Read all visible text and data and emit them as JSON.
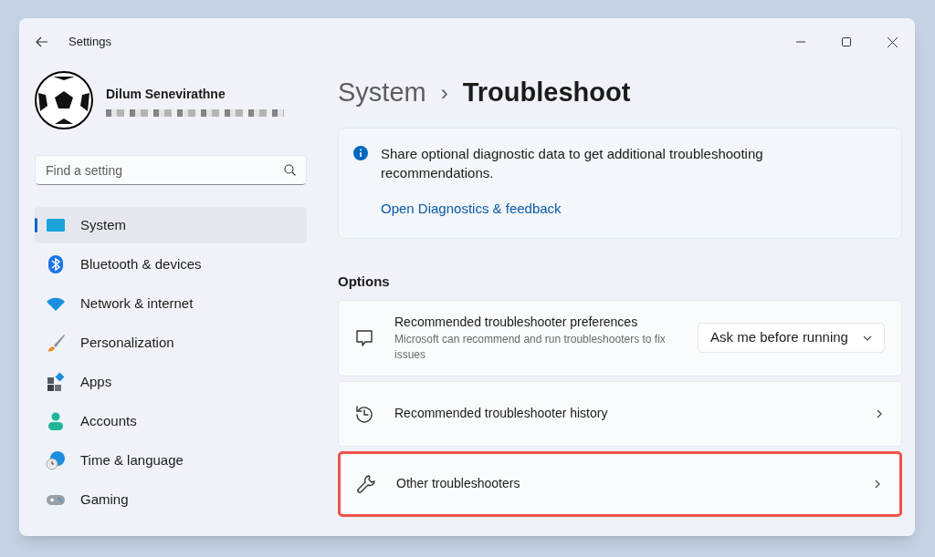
{
  "window": {
    "title": "Settings"
  },
  "profile": {
    "name": "Dilum Senevirathne"
  },
  "search": {
    "placeholder": "Find a setting"
  },
  "sidebar": {
    "items": [
      {
        "label": "System",
        "selected": true
      },
      {
        "label": "Bluetooth & devices",
        "selected": false
      },
      {
        "label": "Network & internet",
        "selected": false
      },
      {
        "label": "Personalization",
        "selected": false
      },
      {
        "label": "Apps",
        "selected": false
      },
      {
        "label": "Accounts",
        "selected": false
      },
      {
        "label": "Time & language",
        "selected": false
      },
      {
        "label": "Gaming",
        "selected": false
      }
    ]
  },
  "breadcrumb": {
    "parent": "System",
    "separator": "›",
    "current": "Troubleshoot"
  },
  "info_card": {
    "text": "Share optional diagnostic data to get additional troubleshooting recommendations.",
    "link": "Open Diagnostics & feedback"
  },
  "options": {
    "heading": "Options",
    "rows": [
      {
        "kind": "dropdown",
        "title": "Recommended troubleshooter preferences",
        "description": "Microsoft can recommend and run troubleshooters to fix issues",
        "value": "Ask me before running",
        "highlighted": false
      },
      {
        "kind": "link",
        "title": "Recommended troubleshooter history",
        "highlighted": false
      },
      {
        "kind": "link",
        "title": "Other troubleshooters",
        "highlighted": true
      }
    ]
  }
}
